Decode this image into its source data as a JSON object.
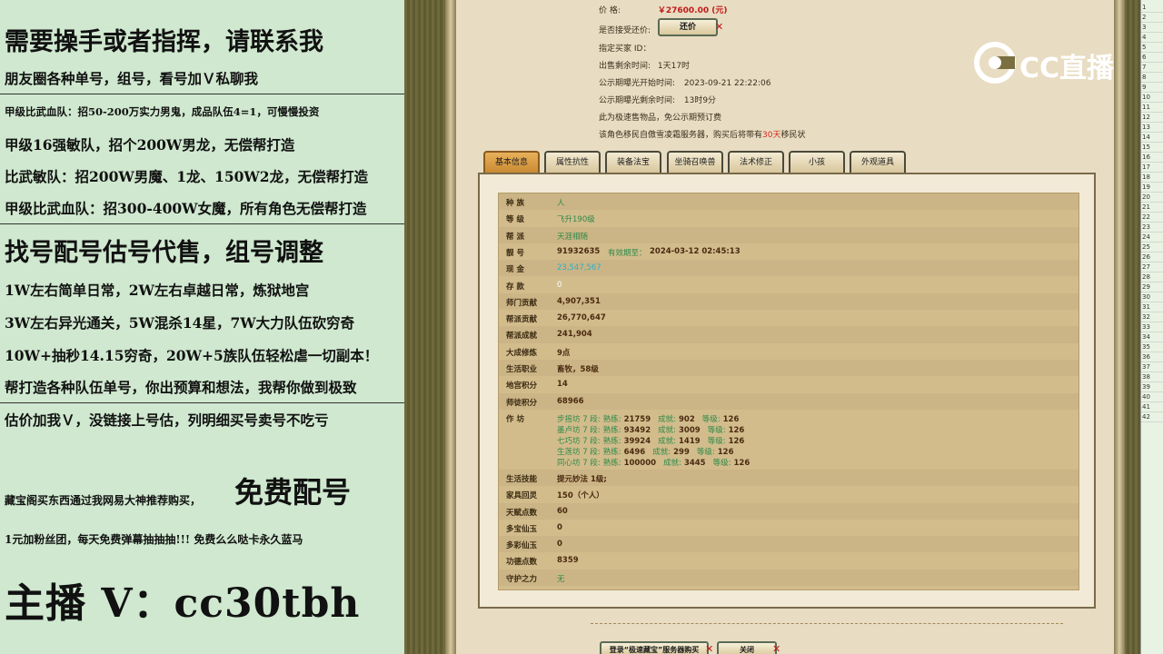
{
  "overlay": {
    "line1": "需要操手或者指挥，请联系我",
    "line2": "朋友圈各种单号，组号，看号加Ｖ私聊我",
    "line3": "甲级比武血队：招50-200万实力男鬼，成品队伍4=1，可慢慢投资",
    "line4": "甲级16强敏队，招个200W男龙，无偿帮打造",
    "line5": "比武敏队：招200W男魔、1龙、150W2龙，无偿帮打造",
    "line6": "甲级比武血队：招300-400W女魔，所有角色无偿帮打造",
    "line7": "找号配号估号代售，组号调整",
    "line8": "1W左右简单日常，2W左右卓越日常，炼狱地宫",
    "line9": "3W左右异光通关，5W混杀14星，7W大力队伍砍穷奇",
    "line10": "10W+抽秒14.15穷奇，20W+5族队伍轻松虐一切副本！",
    "line11": "帮打造各种队伍单号，你出预算和想法，我帮你做到极致",
    "line12": "估价加我Ｖ，没链接上号估，列明细买号卖号不吃亏",
    "line13a": "藏宝阁买东西通过我网易大神推荐购买，",
    "line13b": "免费配号",
    "line14": "1元加粉丝团，每天免费弹幕抽抽抽!!! 免费么么哒卡永久蓝马",
    "line15": "主播 V：cc30tbh"
  },
  "header": {
    "price_label": "价        格:",
    "price_value": "￥27600.00 (元)",
    "bargain_label": "是否接受还价:",
    "bargain_button": "还价",
    "buyer_label": "指定买家 ID：",
    "remain_label": "出售剩余时间:",
    "remain_value": "1天17时",
    "pub_start_label": "公示期曝光开始时间:",
    "pub_start_value": "2023-09-21 22:22:06",
    "pub_remain_label": "公示期曝光剩余时间:",
    "pub_remain_value": "13时9分",
    "note1": "此为极速售物品，免公示期预订费",
    "note2_a": "该角色移民自傲雪凌霜服务器，购买后将带有",
    "note2_b": "30天",
    "note2_c": "移民状"
  },
  "tabs": [
    "基本信息",
    "属性抗性",
    "装备法宝",
    "坐骑召唤兽",
    "法术修正",
    "小孩",
    "外观道具"
  ],
  "rows": [
    {
      "label": "种    族",
      "value": "人",
      "style": "green"
    },
    {
      "label": "等    级",
      "value": "飞升190级",
      "style": "green"
    },
    {
      "label": "帮    派",
      "value": "天涯相随",
      "style": "green"
    },
    {
      "label": "靓    号",
      "value": "91932635",
      "extra_label": "有效期至：",
      "extra_value": "2024-03-12 02:45:13",
      "style": "bold"
    },
    {
      "label": "现    金",
      "value": "23,547,567",
      "style": "cyan"
    },
    {
      "label": "存    款",
      "value": "0",
      "style": "white"
    },
    {
      "label": "师门贡献",
      "value": "4,907,351",
      "style": "bold"
    },
    {
      "label": "帮派贡献",
      "value": "26,770,647",
      "style": "bold"
    },
    {
      "label": "帮派成就",
      "value": "241,904",
      "style": "bold"
    },
    {
      "label": "大成修炼",
      "value": "9点",
      "style": "bold"
    },
    {
      "label": "生活职业",
      "value": "畜牧，58级",
      "style": "bold"
    },
    {
      "label": "地宫积分",
      "value": "14",
      "style": "bold"
    },
    {
      "label": "师徒积分",
      "value": "68966",
      "style": "bold"
    }
  ],
  "workshop": {
    "label": "作    坊",
    "lines": [
      {
        "name": "步摇坊 7 段:",
        "a_label": "熟练:",
        "a": "21759",
        "b_label": "成就:",
        "b": "902",
        "c_label": "等级:",
        "c": "126"
      },
      {
        "name": "墨卢坊 7 段:",
        "a_label": "熟练:",
        "a": "93492",
        "b_label": "成就:",
        "b": "3009",
        "c_label": "等级:",
        "c": "126"
      },
      {
        "name": "七巧坊 7 段:",
        "a_label": "熟练:",
        "a": "39924",
        "b_label": "成就:",
        "b": "1419",
        "c_label": "等级:",
        "c": "126"
      },
      {
        "name": "生莲坊 7 段:",
        "a_label": "熟练:",
        "a": "6496",
        "b_label": "成就:",
        "b": "299",
        "c_label": "等级:",
        "c": "126"
      },
      {
        "name": "同心坊 7 段:",
        "a_label": "熟练:",
        "a": "100000",
        "b_label": "成就:",
        "b": "3445",
        "c_label": "等级:",
        "c": "126"
      }
    ]
  },
  "rows2": [
    {
      "label": "生活技能",
      "value": "提元妙法 1级;",
      "style": "bold"
    },
    {
      "label": "家具回灵",
      "value": "150（个人）",
      "style": "bold"
    },
    {
      "label": "天赋点数",
      "value": "60",
      "style": "bold"
    },
    {
      "label": "多宝仙玉",
      "value": "0",
      "style": "bold"
    },
    {
      "label": "多彩仙玉",
      "value": "0",
      "style": "bold"
    },
    {
      "label": "功德点数",
      "value": "8359",
      "style": "bold"
    },
    {
      "label": "守护之力",
      "value": "无",
      "style": "green"
    }
  ],
  "bottom": {
    "btn1": "登录“极速藏宝”服务器购买",
    "btn2": "关闭"
  },
  "logo": {
    "text": "CC直播"
  },
  "right_strip": [
    "1",
    "2",
    "3",
    "4",
    "5",
    "6",
    "7",
    "8",
    "9",
    "10",
    "11",
    "12",
    "13",
    "14",
    "15",
    "16",
    "17",
    "18",
    "19",
    "20",
    "21",
    "22",
    "23",
    "24",
    "25",
    "26",
    "27",
    "28",
    "29",
    "30",
    "31",
    "32",
    "33",
    "34",
    "35",
    "36",
    "37",
    "38",
    "39",
    "40",
    "41",
    "42"
  ],
  "colors": {
    "overlay_bg": "#cfe8cf",
    "window_bg": "#e8dcc2",
    "price_red": "#c21a1a",
    "tab_active": "#d99a40"
  }
}
